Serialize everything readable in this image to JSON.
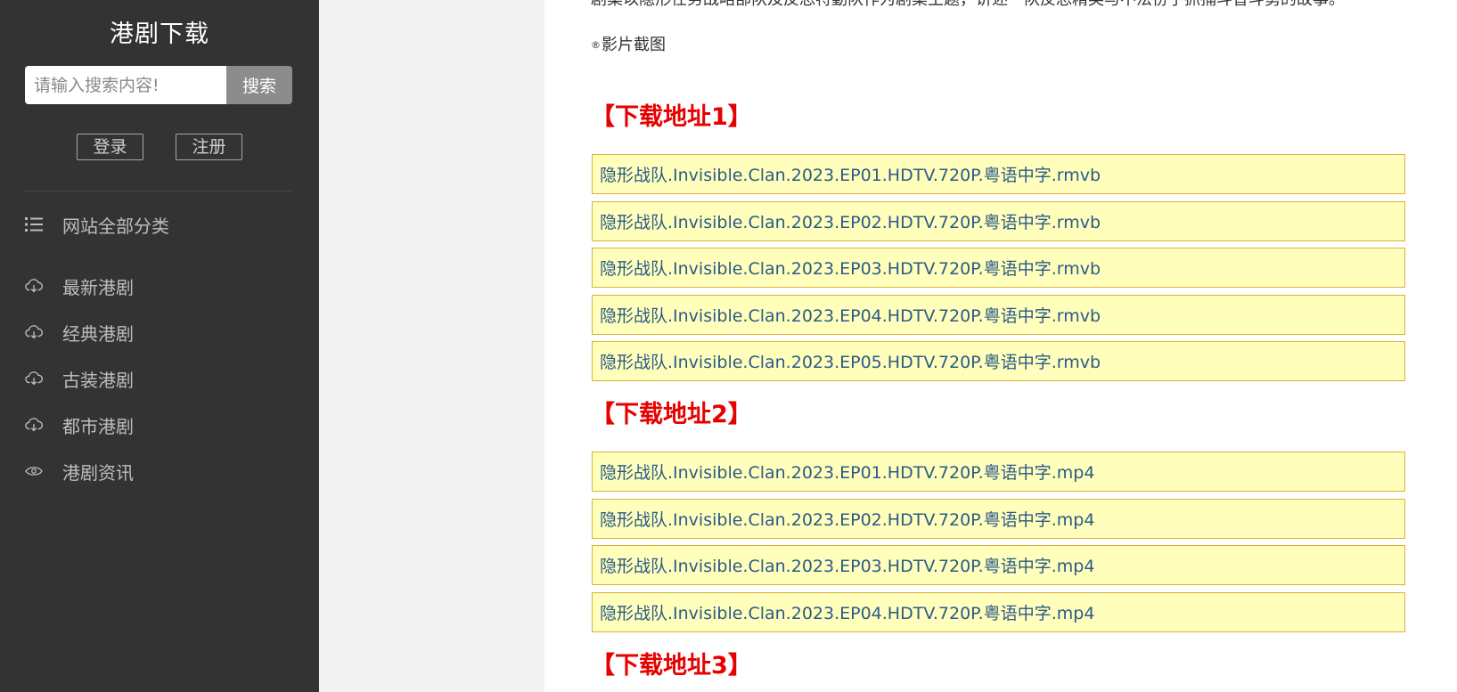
{
  "sidebar": {
    "site_title": "港剧下载",
    "search": {
      "placeholder": "请输入搜索内容!",
      "button_label": "搜索"
    },
    "auth": {
      "login_label": "登录",
      "register_label": "注册"
    },
    "category_all": {
      "label": "网站全部分类",
      "icon": "list-icon"
    },
    "nav_items": [
      {
        "label": "最新港剧",
        "icon": "cloud-download-icon"
      },
      {
        "label": "经典港剧",
        "icon": "cloud-download-icon"
      },
      {
        "label": "古装港剧",
        "icon": "cloud-download-icon"
      },
      {
        "label": "都市港剧",
        "icon": "cloud-download-icon"
      },
      {
        "label": "港剧资讯",
        "icon": "eye-icon"
      }
    ]
  },
  "content": {
    "cut_text": "剧集以隐形任务战略部队及反恐特勤队作为剧集主题，讲述一队反恐精英与不法份子抓捕斗智斗勇的故事。",
    "caption": {
      "mark": "®",
      "text": "影片截图"
    },
    "sections": [
      {
        "title": "【下载地址1】",
        "links": [
          "隐形战队.Invisible.Clan.2023.EP01.HDTV.720P.粤语中字.rmvb",
          "隐形战队.Invisible.Clan.2023.EP02.HDTV.720P.粤语中字.rmvb",
          "隐形战队.Invisible.Clan.2023.EP03.HDTV.720P.粤语中字.rmvb",
          "隐形战队.Invisible.Clan.2023.EP04.HDTV.720P.粤语中字.rmvb",
          "隐形战队.Invisible.Clan.2023.EP05.HDTV.720P.粤语中字.rmvb"
        ]
      },
      {
        "title": "【下载地址2】",
        "links": [
          "隐形战队.Invisible.Clan.2023.EP01.HDTV.720P.粤语中字.mp4",
          "隐形战队.Invisible.Clan.2023.EP02.HDTV.720P.粤语中字.mp4",
          "隐形战队.Invisible.Clan.2023.EP03.HDTV.720P.粤语中字.mp4",
          "隐形战队.Invisible.Clan.2023.EP04.HDTV.720P.粤语中字.mp4"
        ]
      },
      {
        "title": "【下载地址3】",
        "links": []
      }
    ]
  },
  "colors": {
    "sidebar_bg": "#333333",
    "page_bg": "#f2f2f2",
    "section_title": "#e60000",
    "link_bg": "#ffffbb",
    "link_border": "#d9b13b",
    "link_text": "#2a5a8a"
  }
}
